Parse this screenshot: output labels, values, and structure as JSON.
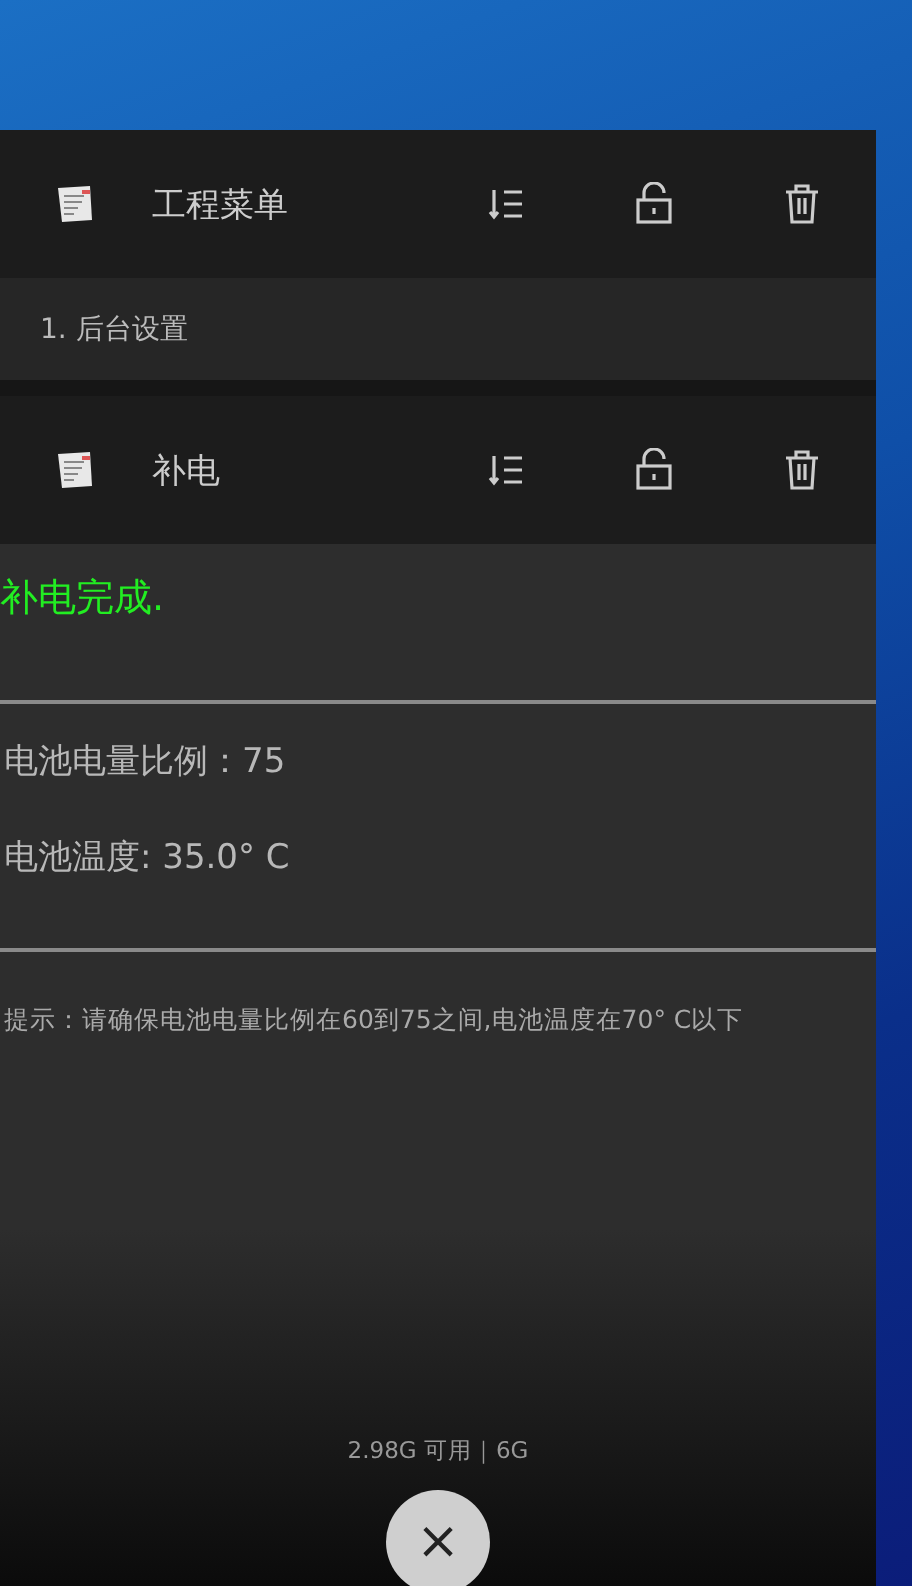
{
  "tasks": [
    {
      "app_name": "工程菜单",
      "content": {
        "kind": "list",
        "items": [
          "1. 后台设置"
        ]
      }
    },
    {
      "app_name": "补电",
      "content": {
        "kind": "status",
        "status": "补电完成.",
        "readings": [
          "电池电量比例：75",
          "电池温度: 35.0° C"
        ],
        "hint": "提示：请确保电池电量比例在60到75之间,电池温度在70° C以下"
      }
    }
  ],
  "memory": "2.98G 可用｜6G",
  "close_button": "×"
}
